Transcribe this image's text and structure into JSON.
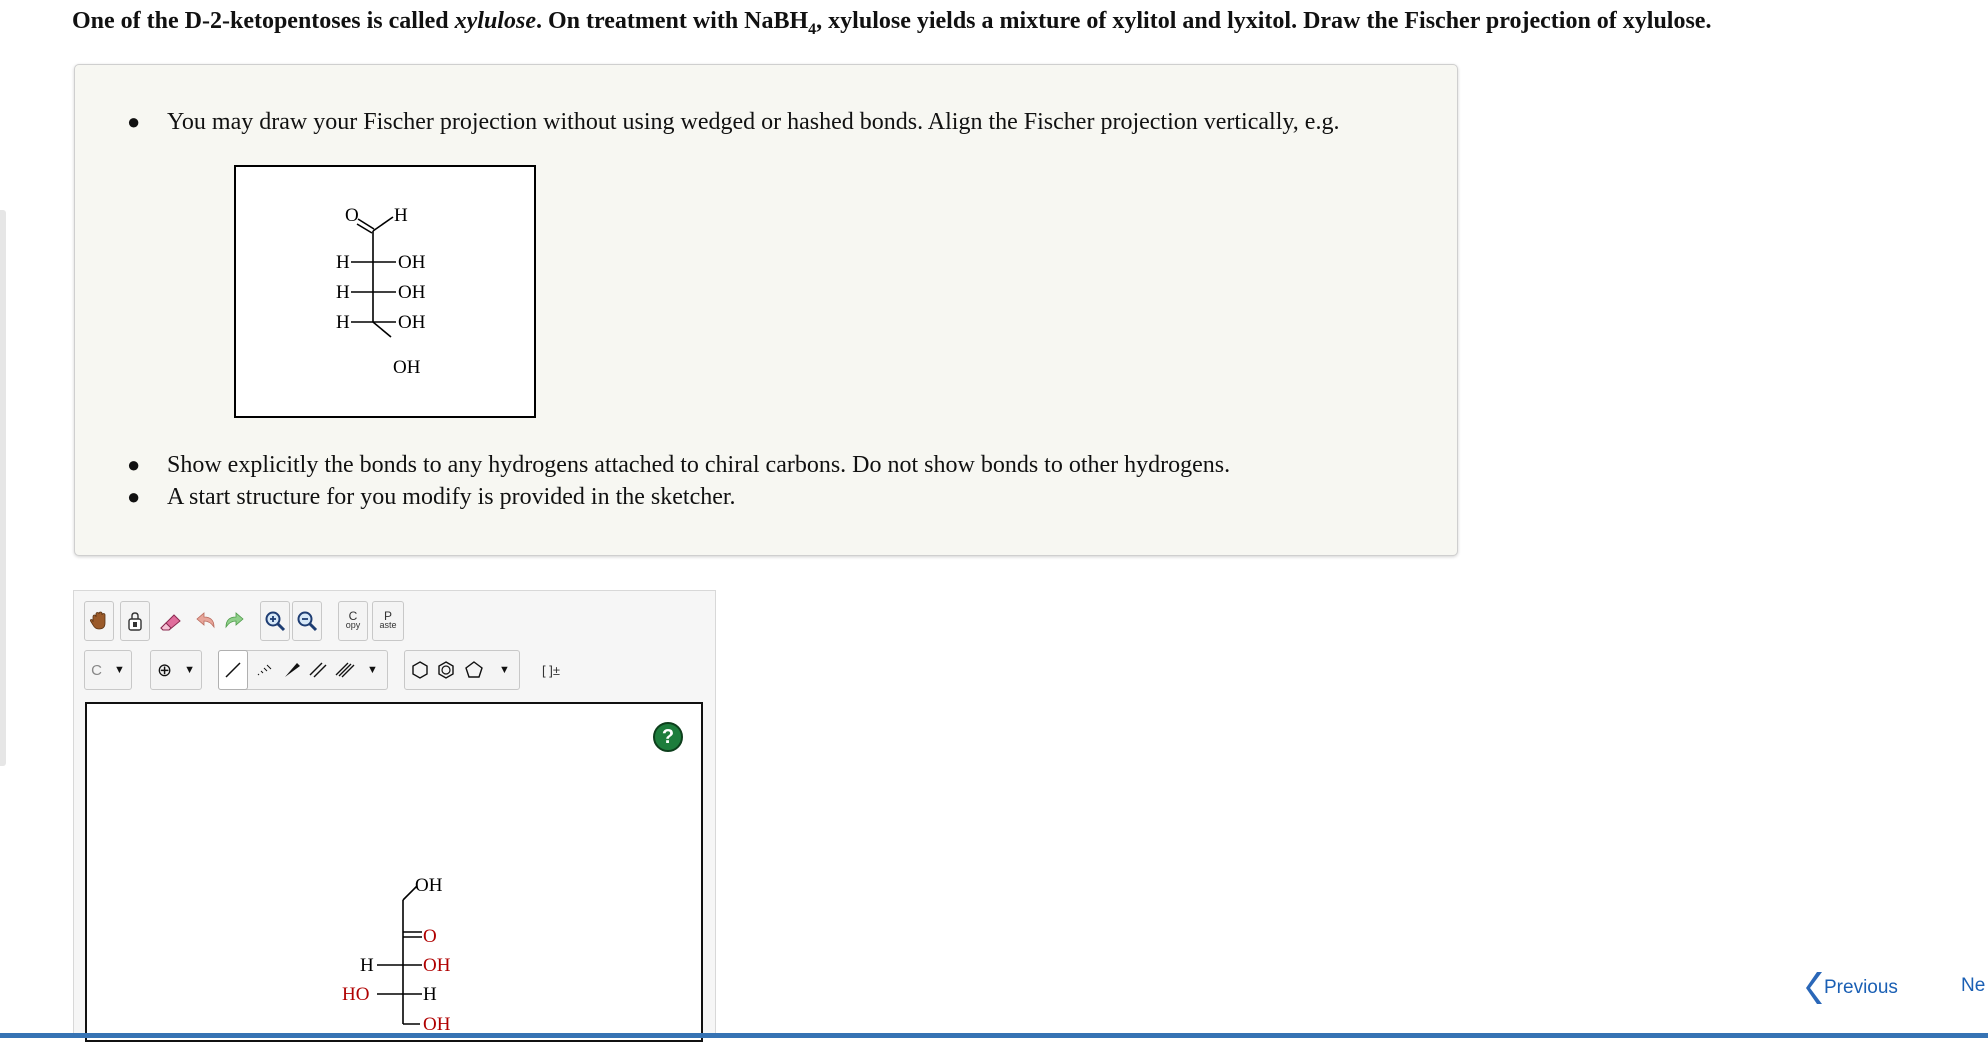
{
  "question": {
    "part1": "One of the D-2-ketopentoses is called ",
    "compound": "xylulose",
    "part2": ". On treatment with NaBH",
    "subscript": "4",
    "part3": ", xylulose yields a mixture of xylitol and lyxitol. Draw the Fischer projection of xylulose."
  },
  "instructions": {
    "bullet1": "You may draw your Fischer projection without using wedged or hashed bonds. Align the Fischer projection vertically, e.g.",
    "bullet2": "Show explicitly the bonds to any hydrogens attached to chiral carbons. Do not show bonds to other hydrogens.",
    "bullet3": "A start structure for you modify is provided in the sketcher."
  },
  "example_structure": {
    "top_O": "O",
    "top_H": "H",
    "rows": [
      {
        "left": "H",
        "right": "OH"
      },
      {
        "left": "H",
        "right": "OH"
      },
      {
        "left": "H",
        "right": "OH"
      }
    ],
    "bottom": "OH"
  },
  "toolbar": {
    "copy_label_top": "C",
    "copy_label_bottom": "opy",
    "paste_label_top": "P",
    "paste_label_bottom": "aste",
    "element_label": "C",
    "bracket_label": "[ ]±",
    "help_label": "?"
  },
  "start_structure": {
    "top": "OH",
    "carbonyl": "O",
    "rows": [
      {
        "left": "H",
        "right": "OH"
      },
      {
        "left": "HO",
        "right": "H"
      }
    ],
    "bottom": "OH"
  },
  "navigation": {
    "previous": "Previous",
    "next": "Ne"
  }
}
